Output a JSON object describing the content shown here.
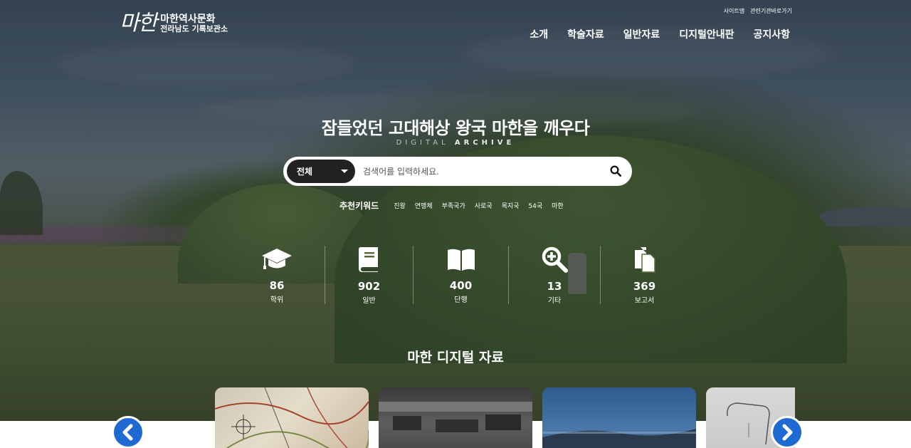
{
  "header": {
    "logo_mark": "마한",
    "logo_line1": "마한역사문화",
    "logo_line2": "전라남도 기록보관소",
    "util_links": [
      "사이트맵",
      "관련기관바로가기"
    ],
    "nav": [
      "소개",
      "학술자료",
      "일반자료",
      "디지털안내판",
      "공지사항"
    ]
  },
  "hero": {
    "headline": "잠들었던 고대해상 왕국 마한을 깨우다",
    "sub_light": "DIGITAL",
    "sub_bold": "ARCHIVE"
  },
  "search": {
    "select_value": "전체",
    "placeholder": "검색어를 입력하세요.",
    "button_icon": "search-icon"
  },
  "keywords": {
    "title": "추천키워드",
    "items": [
      "진왕",
      "연맹체",
      "부족국가",
      "사로국",
      "목지국",
      "54국",
      "마한"
    ]
  },
  "stats": [
    {
      "icon": "graduation-cap-icon",
      "value": "86",
      "label": "학위"
    },
    {
      "icon": "book-icon",
      "value": "902",
      "label": "일반"
    },
    {
      "icon": "open-book-icon",
      "value": "400",
      "label": "단행"
    },
    {
      "icon": "zoom-in-icon",
      "value": "13",
      "label": "기타"
    },
    {
      "icon": "documents-icon",
      "value": "369",
      "label": "보고서"
    }
  ],
  "section": {
    "title": "마한 디지털 자료"
  },
  "carousel": {
    "prev_icon": "chevron-left-icon",
    "next_icon": "chevron-right-icon",
    "accent_color": "#1e6ad2"
  }
}
